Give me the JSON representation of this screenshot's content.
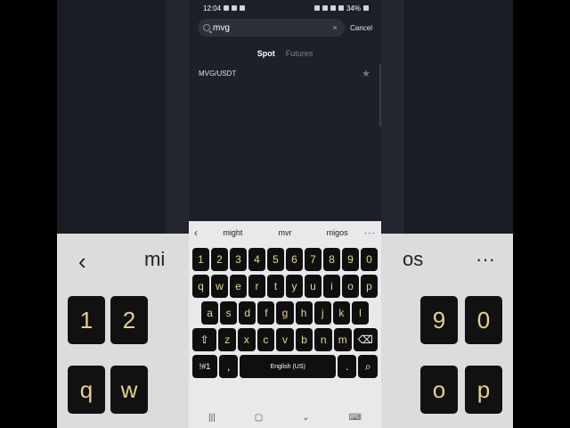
{
  "status": {
    "time": "12:04",
    "battery": "34%"
  },
  "search": {
    "value": "mvg",
    "placeholder": "",
    "cancel_label": "Cancel",
    "clear_glyph": "×"
  },
  "tabs": [
    {
      "label": "Spot",
      "active": true
    },
    {
      "label": "Futures",
      "active": false
    }
  ],
  "results": [
    {
      "pair": "MVG/USDT"
    }
  ],
  "keyboard": {
    "suggestions": [
      "might",
      "mvr",
      "migos"
    ],
    "more_glyph": "···",
    "back_glyph": "‹",
    "row_numbers": [
      "1",
      "2",
      "3",
      "4",
      "5",
      "6",
      "7",
      "8",
      "9",
      "0"
    ],
    "row1": [
      "q",
      "w",
      "e",
      "r",
      "t",
      "y",
      "u",
      "i",
      "o",
      "p"
    ],
    "row2": [
      "a",
      "s",
      "d",
      "f",
      "g",
      "h",
      "j",
      "k",
      "l"
    ],
    "row3": [
      "z",
      "x",
      "c",
      "v",
      "b",
      "n",
      "m"
    ],
    "symbols_label": "!#1",
    "comma_label": ",",
    "space_label": "English (US)",
    "period_label": "."
  },
  "background_blur": {
    "left_text": "mi",
    "right_text": "os",
    "keys_left": [
      "1",
      "2",
      "q",
      "w"
    ],
    "keys_right": [
      "9",
      "0",
      "o",
      "p"
    ]
  },
  "colors": {
    "key_text": "#ead58e",
    "app_bg": "#1d2028"
  }
}
